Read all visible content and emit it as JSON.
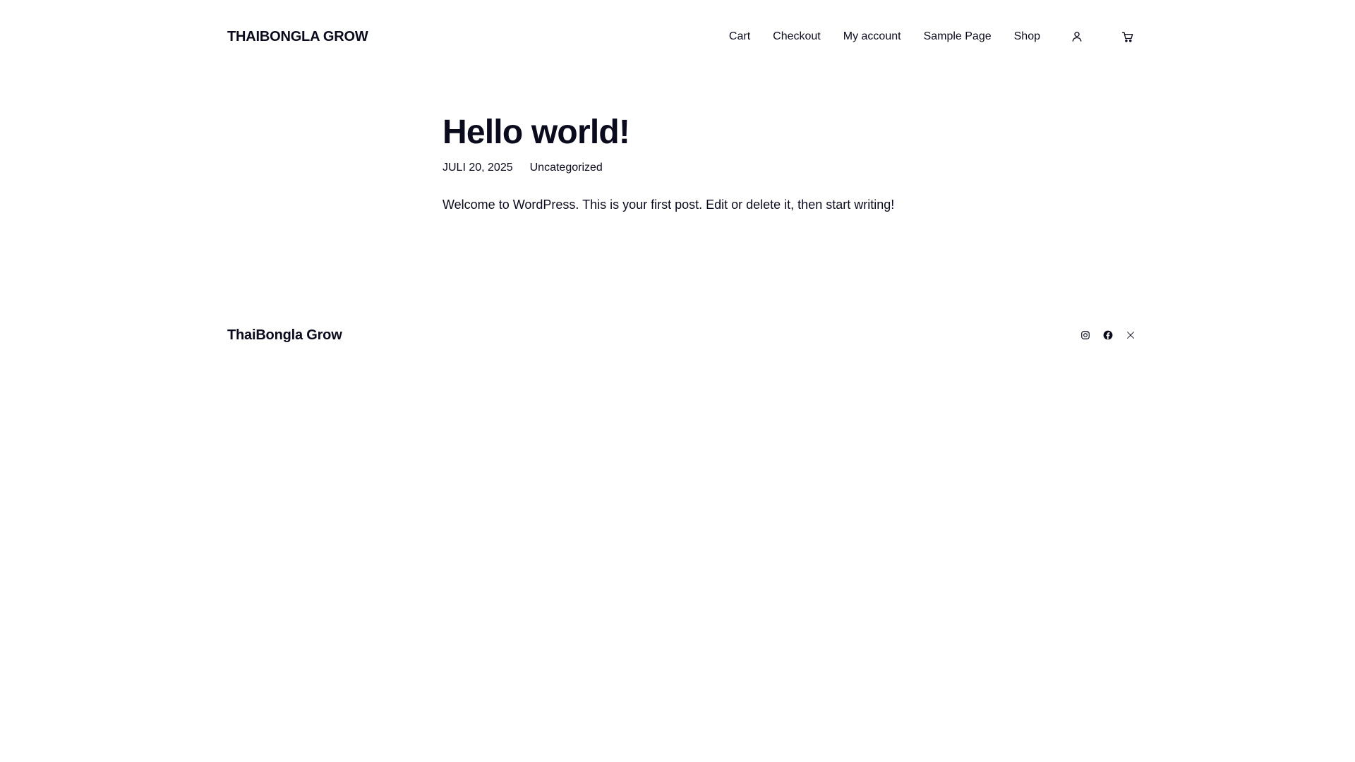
{
  "header": {
    "site_title": "THAIBONGLA GROW",
    "nav": [
      {
        "label": "Cart"
      },
      {
        "label": "Checkout"
      },
      {
        "label": "My account"
      },
      {
        "label": "Sample Page"
      },
      {
        "label": "Shop"
      }
    ],
    "icons": {
      "account": "user-icon",
      "cart": "cart-icon"
    }
  },
  "post": {
    "title": "Hello world!",
    "date": "JULI 20, 2025",
    "category": "Uncategorized",
    "body": "Welcome to WordPress. This is your first post. Edit or delete it, then start writing!"
  },
  "footer": {
    "site_title": "ThaiBongla Grow",
    "social": [
      {
        "icon": "instagram-icon"
      },
      {
        "icon": "facebook-icon"
      },
      {
        "icon": "x-icon"
      }
    ]
  },
  "colors": {
    "text": "#0b0b1e",
    "background": "#ffffff"
  }
}
